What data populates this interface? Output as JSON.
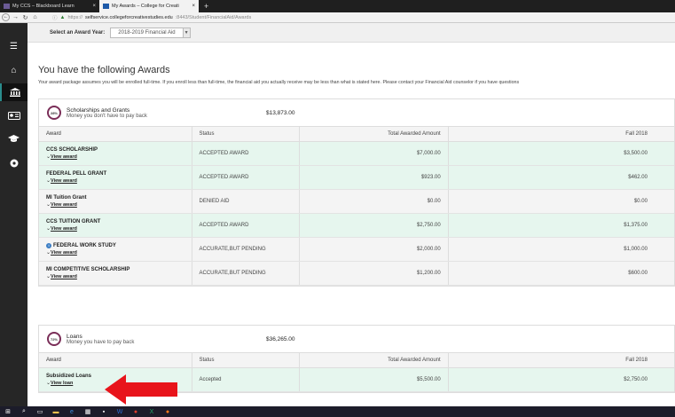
{
  "browser": {
    "tabs": [
      {
        "label": "My CCS – Blackboard Learn",
        "close": "×"
      },
      {
        "label": "My Awards – College for Creati",
        "close": "×"
      }
    ],
    "new_tab": "+",
    "url_prefix": "https://",
    "url_host": "selfservice.collegeforcreativestudies.edu",
    "url_path": ":8443/Student/FinancialAid/Awards"
  },
  "award_year": {
    "label": "Select an Award Year:",
    "value": "2018-2019 Financial Aid"
  },
  "page": {
    "title": "You have the following Awards",
    "subtitle": "Your award package assumes you will be enrolled full-time. If you enroll less than full-time, the financial aid you actually receive may be less than what is stated here. Please contact your Financial Aid counselor if you have questions"
  },
  "table_headers": {
    "award": "Award",
    "status": "Status",
    "total": "Total Awarded Amount",
    "term": "Fall 2018"
  },
  "grants": {
    "percent": "28%",
    "title": "Scholarships and Grants",
    "subtitle": "Money you don't have to pay back",
    "amount": "$13,873.00",
    "rows": [
      {
        "name": "CCS SCHOLARSHIP",
        "link": "View award",
        "status": "ACCEPTED AWARD",
        "total": "$7,000.00",
        "term": "$3,500.00"
      },
      {
        "name": "FEDERAL PELL GRANT",
        "link": "View award",
        "status": "ACCEPTED AWARD",
        "total": "$923.00",
        "term": "$462.00"
      },
      {
        "name": "MI Tuition Grant",
        "link": "View award",
        "status": "DENIED AID",
        "total": "$0.00",
        "term": "$0.00"
      },
      {
        "name": "CCS TUITION GRANT",
        "link": "View award",
        "status": "ACCEPTED AWARD",
        "total": "$2,750.00",
        "term": "$1,375.00"
      },
      {
        "name": "FEDERAL WORK STUDY",
        "link": "View award",
        "status": "ACCURATE,BUT PENDING",
        "total": "$2,000.00",
        "term": "$1,000.00"
      },
      {
        "name": "MI COMPETITIVE SCHOLARSHIP",
        "link": "View award",
        "status": "ACCURATE,BUT PENDING",
        "total": "$1,200.00",
        "term": "$600.00"
      }
    ]
  },
  "loans": {
    "percent": "72%",
    "title": "Loans",
    "subtitle": "Money you have to pay back",
    "amount": "$36,265.00",
    "rows": [
      {
        "name": "Subsidized Loans",
        "link": "View loan",
        "status": "Accepted",
        "total": "$5,500.00",
        "term": "$2,750.00"
      }
    ]
  },
  "colors": {
    "accepted_row": "#e6f6ee",
    "rail": "#262626",
    "arrow": "#e8141b"
  },
  "icons": [
    "menu-icon",
    "home-icon",
    "institution-icon",
    "id-card-icon",
    "graduation-cap-icon",
    "settings-icon"
  ]
}
